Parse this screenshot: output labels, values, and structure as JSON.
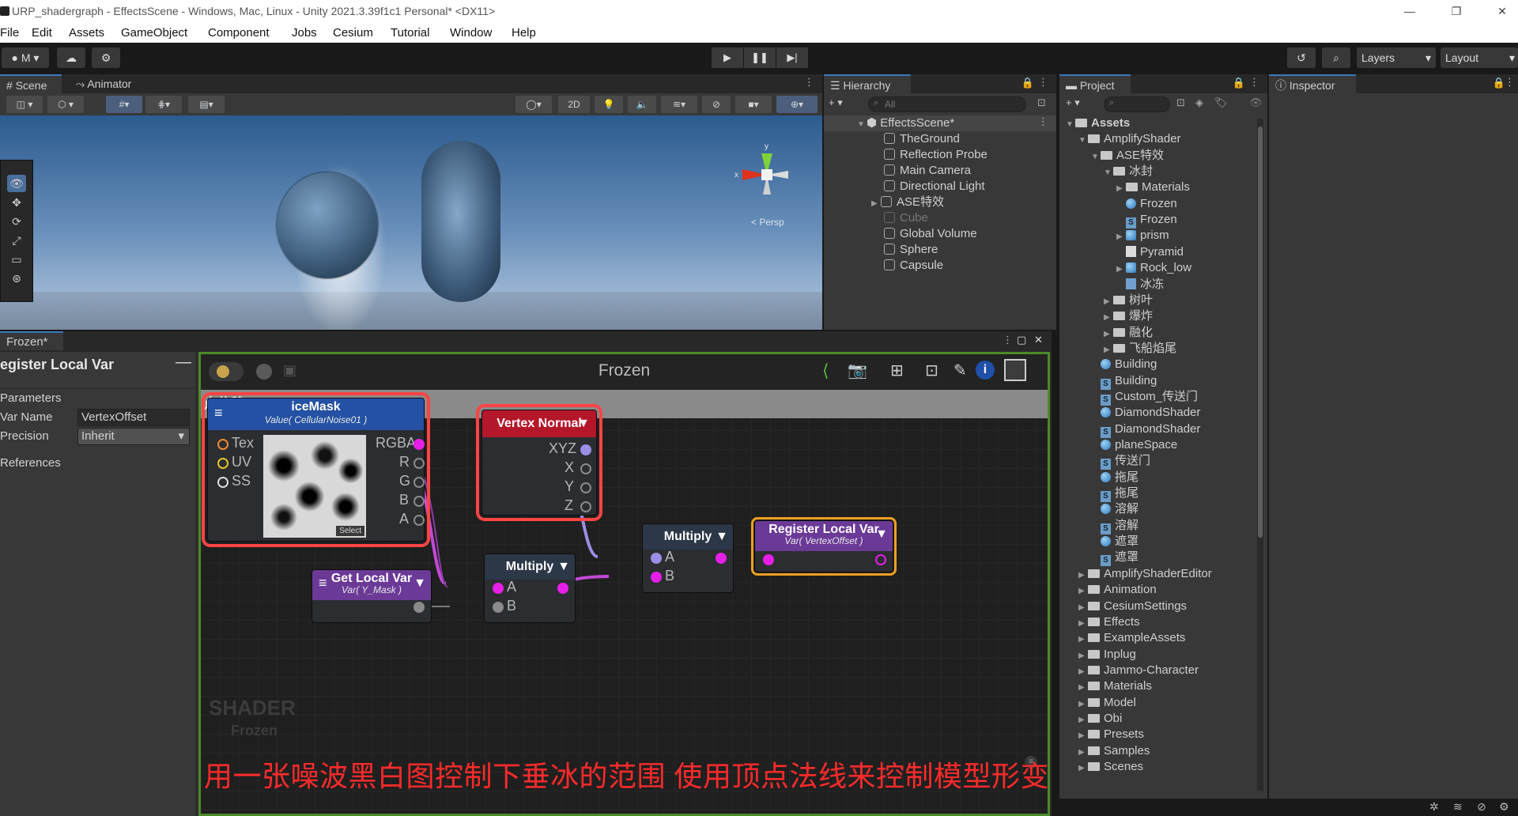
{
  "window": {
    "title": "URP_shadergraph - EffectsScene - Windows, Mac, Linux - Unity 2021.3.39f1c1 Personal* <DX11>",
    "minimize": "—",
    "maximize": "❐",
    "close": "✕"
  },
  "menu": [
    "File",
    "Edit",
    "Assets",
    "GameObject",
    "Component",
    "Jobs",
    "Cesium",
    "Tutorial",
    "Window",
    "Help"
  ],
  "toolbar": {
    "account": "M",
    "layers": "Layers",
    "layout": "Layout"
  },
  "scene": {
    "tabs": [
      "Scene",
      "Animator"
    ],
    "mode_2d": "2D",
    "persp": "< Persp",
    "axis_x": "x",
    "axis_y": "y"
  },
  "hierarchy": {
    "tab": "Hierarchy",
    "search_placeholder": "All",
    "scene_name": "EffectsScene*",
    "items": [
      "TheGround",
      "Reflection Probe",
      "Main Camera",
      "Directional Light",
      "ASE特效",
      "Cube",
      "Global Volume",
      "Sphere",
      "Capsule"
    ]
  },
  "project": {
    "tab": "Project",
    "rows": [
      {
        "label": "Assets",
        "kind": "folder",
        "depth": 0,
        "open": true
      },
      {
        "label": "AmplifyShader",
        "kind": "folder",
        "depth": 1,
        "open": true
      },
      {
        "label": "ASE特效",
        "kind": "folder",
        "depth": 2,
        "open": true
      },
      {
        "label": "冰封",
        "kind": "folder",
        "depth": 3,
        "open": true
      },
      {
        "label": "Materials",
        "kind": "folder",
        "depth": 4,
        "open": false
      },
      {
        "label": "Frozen",
        "kind": "mat",
        "depth": 4
      },
      {
        "label": "Frozen",
        "kind": "shader",
        "depth": 4
      },
      {
        "label": "prism",
        "kind": "model",
        "depth": 4,
        "open": false
      },
      {
        "label": "Pyramid",
        "kind": "white",
        "depth": 4
      },
      {
        "label": "Rock_low",
        "kind": "model",
        "depth": 4,
        "open": false
      },
      {
        "label": "冰冻",
        "kind": "tex",
        "depth": 4
      },
      {
        "label": "树叶",
        "kind": "folder",
        "depth": 3,
        "open": false
      },
      {
        "label": "爆炸",
        "kind": "folder",
        "depth": 3,
        "open": false
      },
      {
        "label": "融化",
        "kind": "folder",
        "depth": 3,
        "open": false
      },
      {
        "label": "飞船焰尾",
        "kind": "folder",
        "depth": 3,
        "open": false
      },
      {
        "label": "Building",
        "kind": "mat",
        "depth": 2
      },
      {
        "label": "Building",
        "kind": "shader",
        "depth": 2
      },
      {
        "label": "Custom_传送门",
        "kind": "shader",
        "depth": 2
      },
      {
        "label": "DiamondShader",
        "kind": "mat",
        "depth": 2
      },
      {
        "label": "DiamondShader",
        "kind": "shader",
        "depth": 2
      },
      {
        "label": "planeSpace",
        "kind": "mat",
        "depth": 2
      },
      {
        "label": "传送门",
        "kind": "shader",
        "depth": 2
      },
      {
        "label": "拖尾",
        "kind": "mat",
        "depth": 2
      },
      {
        "label": "拖尾",
        "kind": "shader",
        "depth": 2
      },
      {
        "label": "溶解",
        "kind": "mat",
        "depth": 2
      },
      {
        "label": "溶解",
        "kind": "shader",
        "depth": 2
      },
      {
        "label": "遮罩",
        "kind": "mat",
        "depth": 2
      },
      {
        "label": "遮罩",
        "kind": "shader",
        "depth": 2
      },
      {
        "label": "AmplifyShaderEditor",
        "kind": "folder",
        "depth": 1,
        "open": false
      },
      {
        "label": "Animation",
        "kind": "folder",
        "depth": 1,
        "open": false
      },
      {
        "label": "CesiumSettings",
        "kind": "folder",
        "depth": 1,
        "open": false
      },
      {
        "label": "Effects",
        "kind": "folder",
        "depth": 1,
        "open": false
      },
      {
        "label": "ExampleAssets",
        "kind": "folder",
        "depth": 1,
        "open": false
      },
      {
        "label": "Inplug",
        "kind": "folder",
        "depth": 1,
        "open": false
      },
      {
        "label": "Jammo-Character",
        "kind": "folder",
        "depth": 1,
        "open": false
      },
      {
        "label": "Materials",
        "kind": "folder",
        "depth": 1,
        "open": false
      },
      {
        "label": "Model",
        "kind": "folder",
        "depth": 1,
        "open": false
      },
      {
        "label": "Obi",
        "kind": "folder",
        "depth": 1,
        "open": false
      },
      {
        "label": "Presets",
        "kind": "folder",
        "depth": 1,
        "open": false
      },
      {
        "label": "Samples",
        "kind": "folder",
        "depth": 1,
        "open": false
      },
      {
        "label": "Scenes",
        "kind": "folder",
        "depth": 1,
        "open": false
      }
    ]
  },
  "inspector": {
    "tab": "Inspector"
  },
  "shader_editor": {
    "tab": "Frozen*",
    "title": "Frozen",
    "param_title": "egister Local Var",
    "parameters_label": "Parameters",
    "var_name_label": "Var Name",
    "var_name_value": "VertexOffset",
    "precision_label": "Precision",
    "precision_value": "Inherit",
    "references_label": "References",
    "group_title": "点偏移",
    "watermark_1": "SHADER",
    "watermark_2": "Frozen",
    "nodes": {
      "icemask": {
        "title": "iceMask",
        "subtitle": "Value( CellularNoise01 )",
        "in": [
          "Tex",
          "UV",
          "SS"
        ],
        "out": [
          "RGBA",
          "R",
          "G",
          "B",
          "A"
        ],
        "select": "Select"
      },
      "vertex_normal": {
        "title": "Vertex Normal",
        "out": [
          "XYZ",
          "X",
          "Y",
          "Z"
        ]
      },
      "get_local_var": {
        "title": "Get Local Var",
        "subtitle": "Var( Y_Mask )"
      },
      "multiply1": {
        "title": "Multiply",
        "in": [
          "A",
          "B"
        ]
      },
      "multiply2": {
        "title": "Multiply",
        "in": [
          "A",
          "B"
        ]
      },
      "register": {
        "title": "Register Local Var",
        "subtitle": "Var( VertexOffset )"
      }
    },
    "annotation": "用一张噪波黑白图控制下垂冰的范围   使用顶点法线来控制模型形变"
  },
  "colors": {
    "accent": "#3a79bb",
    "node_blue": "#2451a3",
    "node_red": "#b5172a",
    "node_purple": "#6b3a97",
    "node_dark": "#2c3748",
    "port_magenta": "#e61fe6",
    "port_lilac": "#9b8ee6",
    "selection_red": "#ff4444",
    "selection_orange": "#f0a020",
    "group_border": "#4b8a2b",
    "annotation": "#ff2a2a"
  }
}
